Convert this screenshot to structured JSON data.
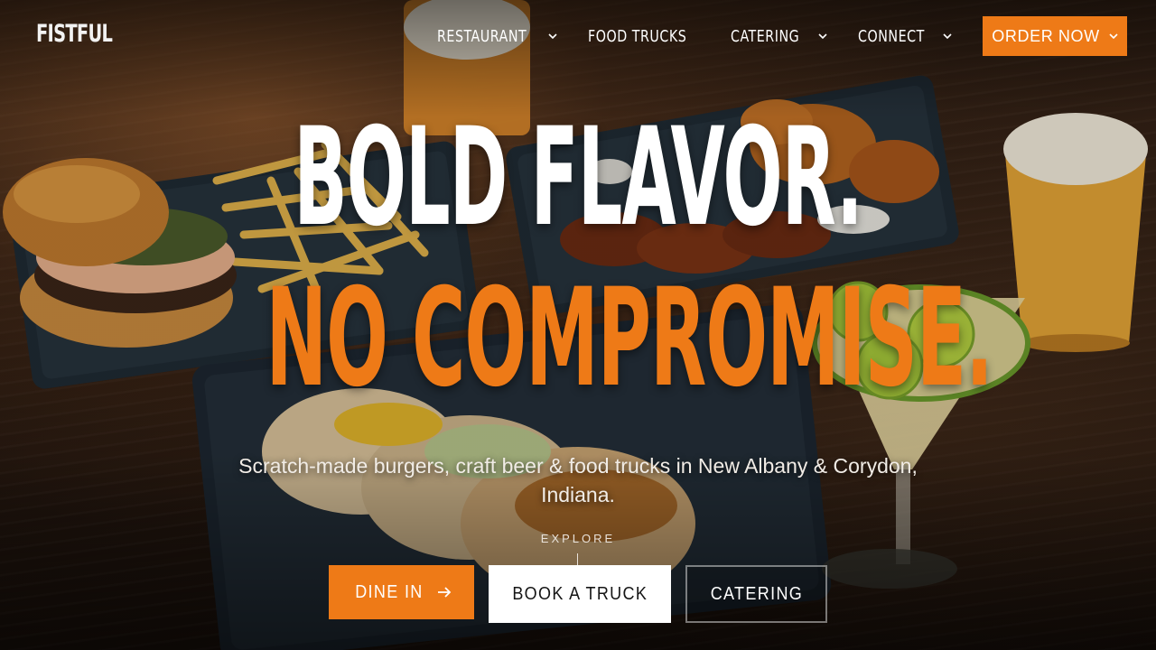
{
  "brand": {
    "logo_text": "FISTFUL"
  },
  "nav": {
    "items": [
      {
        "label": "RESTAURANT",
        "has_dropdown": true
      },
      {
        "label": "FOOD TRUCKS",
        "has_dropdown": false
      },
      {
        "label": "CATERING",
        "has_dropdown": true
      },
      {
        "label": "CONNECT",
        "has_dropdown": true
      }
    ],
    "order_button": {
      "label": "ORDER NOW",
      "has_dropdown": true
    }
  },
  "hero": {
    "headline_1": "BOLD FLAVOR.",
    "headline_2": "NO COMPROMISE.",
    "subtitle": "Scratch-made burgers, craft beer & food trucks in New Albany & Corydon, Indiana.",
    "explore_label": "EXPLORE"
  },
  "cta": {
    "dine_in": "DINE IN",
    "book_truck": "BOOK A TRUCK",
    "catering": "CATERING"
  },
  "colors": {
    "accent": "#ee7a17",
    "text": "#ffffff",
    "background": "#2c1c12"
  },
  "icons": {
    "dropdown": "chevron-down-icon",
    "arrow": "arrow-right-icon"
  }
}
